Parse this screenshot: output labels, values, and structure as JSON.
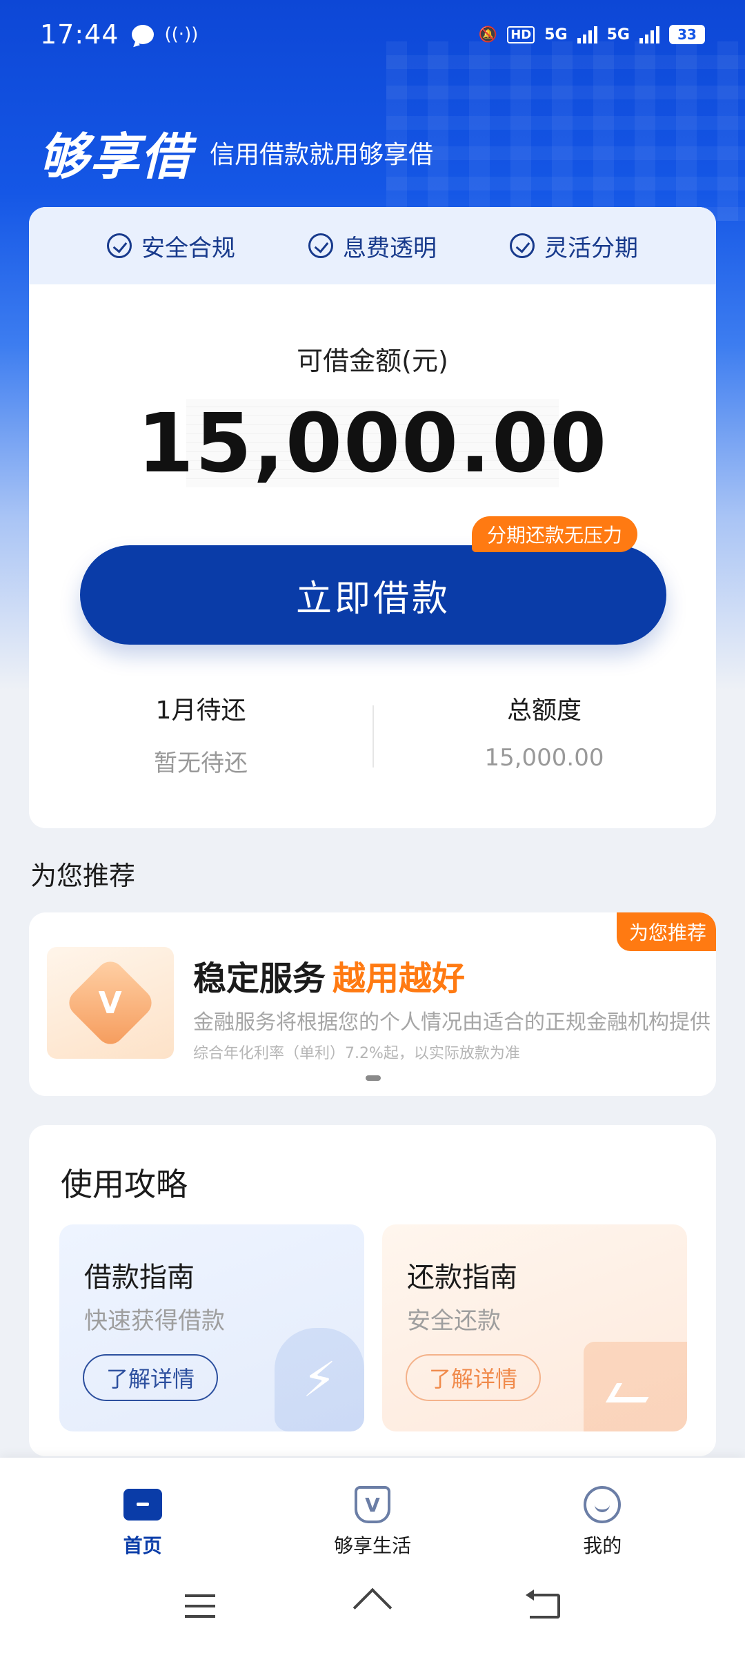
{
  "status_bar": {
    "time": "17:44",
    "hd": "HD",
    "net1": "5G",
    "net2": "5G",
    "battery": "33"
  },
  "header": {
    "logo": "够享借",
    "slogan": "信用借款就用够享借"
  },
  "features": [
    "安全合规",
    "息费透明",
    "灵活分期"
  ],
  "loan": {
    "amount_label": "可借金额(元)",
    "amount": "15,000.00",
    "button_label": "立即借款",
    "button_tag": "分期还款无压力",
    "stats": [
      {
        "title": "1月待还",
        "value": "暂无待还"
      },
      {
        "title": "总额度",
        "value": "15,000.00"
      }
    ]
  },
  "recommend": {
    "section_title": "为您推荐",
    "tag": "为您推荐",
    "title_main": "稳定服务",
    "title_accent": "越用越好",
    "desc": "金融服务将根据您的个人情况由适合的正规金融机构提供",
    "note": "综合年化利率（单利）7.2%起，以实际放款为准"
  },
  "guide": {
    "title": "使用攻略",
    "items": [
      {
        "title": "借款指南",
        "subtitle": "快速获得借款",
        "button": "了解详情"
      },
      {
        "title": "还款指南",
        "subtitle": "安全还款",
        "button": "了解详情"
      }
    ]
  },
  "bottom_nav": {
    "tabs": [
      {
        "label": "首页",
        "icon": "home-icon",
        "active": true
      },
      {
        "label": "够享生活",
        "icon": "life-icon",
        "active": false
      },
      {
        "label": "我的",
        "icon": "profile-icon",
        "active": false
      }
    ]
  },
  "colors": {
    "primary": "#0a3ca8",
    "accent": "#ff7a12"
  }
}
